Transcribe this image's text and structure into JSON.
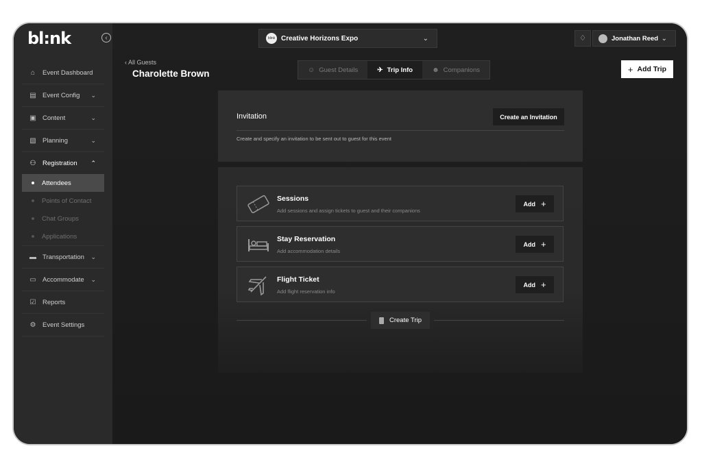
{
  "app": {
    "logo": "bl:nk",
    "collapse_icon": "‹"
  },
  "header": {
    "event_logo_text": "blink",
    "event_name": "Creative Horizons Expo",
    "user_name": "Jonathan Reed"
  },
  "sidebar": {
    "items": [
      {
        "label": "Event Dashboard",
        "icon": "home-icon",
        "glyph": "⌂"
      },
      {
        "label": "Event Config",
        "icon": "calendar-settings-icon",
        "glyph": "▤"
      },
      {
        "label": "Content",
        "icon": "content-icon",
        "glyph": "▣"
      },
      {
        "label": "Planning",
        "icon": "planning-icon",
        "glyph": "▧"
      },
      {
        "label": "Registration",
        "icon": "people-icon",
        "glyph": "⚇"
      },
      {
        "label": "Transportation",
        "icon": "car-icon",
        "glyph": "▬"
      },
      {
        "label": "Accommodate",
        "icon": "bed-icon",
        "glyph": "▭"
      },
      {
        "label": "Reports",
        "icon": "reports-icon",
        "glyph": "☑"
      },
      {
        "label": "Event Settings",
        "icon": "gear-icon",
        "glyph": "⚙"
      }
    ],
    "registration_sub": [
      "Attendees",
      "Points of Contact",
      "Chat Groups",
      "Applications"
    ]
  },
  "guest": {
    "back_label": "All Guests",
    "name": "Charolette Brown"
  },
  "tabs": [
    {
      "label": "Guest Details"
    },
    {
      "label": "Trip Info"
    },
    {
      "label": "Companions"
    }
  ],
  "add_trip_label": "Add Trip",
  "invitation": {
    "title": "Invitation",
    "button": "Create an Invitation",
    "description": "Create and specify an invitation to be sent out to guest for this event"
  },
  "trip_sections": [
    {
      "title": "Sessions",
      "description": "Add sessions and assign tickets to guest and their companions",
      "button": "Add",
      "icon": "ticket-icon"
    },
    {
      "title": "Stay Reservation",
      "description": "Add accommodation details",
      "button": "Add",
      "icon": "bed-icon"
    },
    {
      "title": "Flight Ticket",
      "description": "Add flight reservation info",
      "button": "Add",
      "icon": "airplane-icon"
    }
  ],
  "create_trip_label": "Create Trip"
}
